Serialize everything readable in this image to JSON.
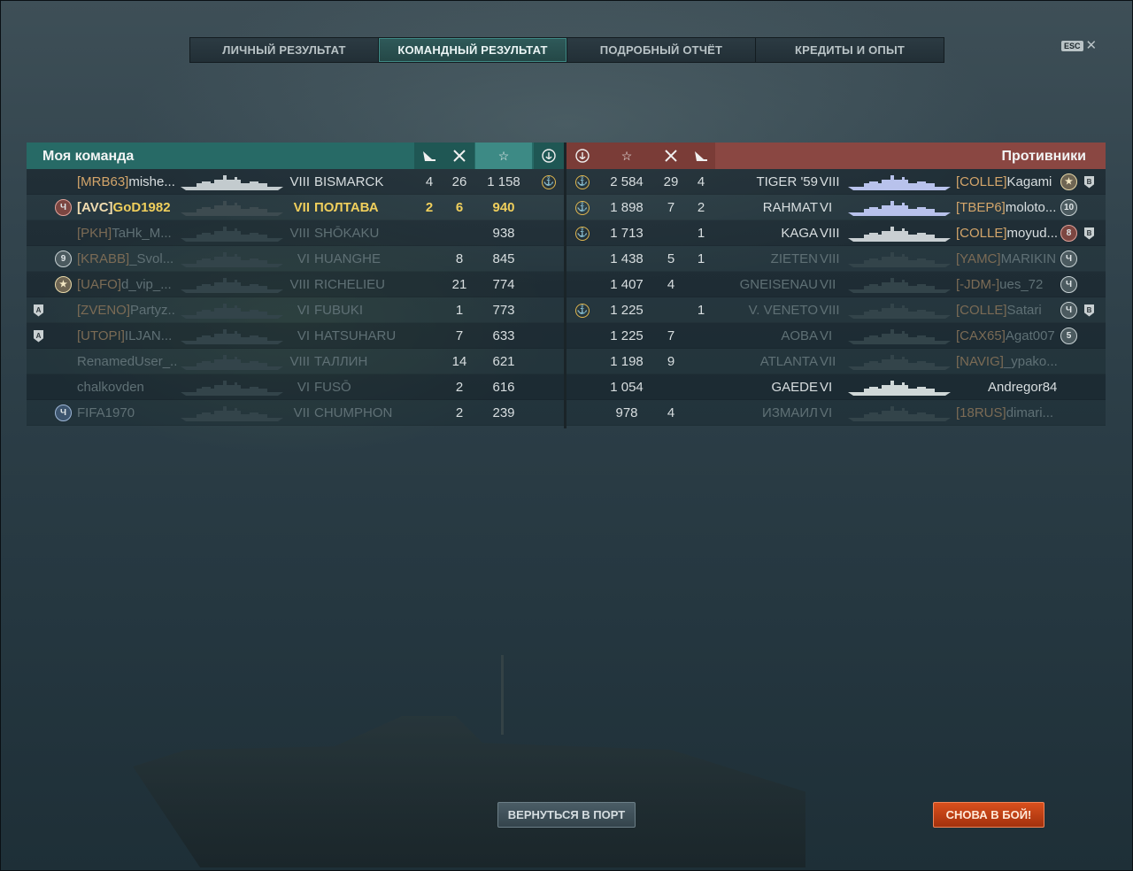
{
  "tabs": [
    {
      "label": "ЛИЧНЫЙ РЕЗУЛЬТАТ",
      "active": false
    },
    {
      "label": "КОМАНДНЫЙ РЕЗУЛЬТАТ",
      "active": true
    },
    {
      "label": "ПОДРОБНЫЙ ОТЧЁТ",
      "active": false
    },
    {
      "label": "КРЕДИТЫ И ОПЫТ",
      "active": false
    }
  ],
  "esc_key": "ESC",
  "close_glyph": "✕",
  "ally": {
    "title": "Моя команда",
    "header_icons": [
      "torpedo-icon",
      "frags-icon",
      "star-icon",
      "anchor-icon"
    ],
    "rows": [
      {
        "badge": "",
        "clan": "[MRB63]",
        "name": "mishe...",
        "tier": "VIII",
        "ship": "BISMARCK",
        "torpedo": "4",
        "frags": "26",
        "xp": "1 158",
        "anchor": true,
        "state": "alive"
      },
      {
        "badge": "Ч",
        "badge_style": "red",
        "clan": "[AVC]",
        "name": "GoD1982",
        "tier": "VII",
        "ship": "ПОЛТАВА",
        "torpedo": "2",
        "frags": "6",
        "xp": "940",
        "anchor": false,
        "state": "me"
      },
      {
        "badge": "",
        "clan": "[PKH]",
        "name": "TaHk_M...",
        "tier": "VIII",
        "ship": "SHŌKAKU",
        "torpedo": "",
        "frags": "",
        "xp": "938",
        "anchor": false,
        "state": "dead"
      },
      {
        "badge": "9",
        "clan": "[KRABB]",
        "name": "_Svol...",
        "tier": "VI",
        "ship": "HUANGHE",
        "torpedo": "",
        "frags": "8",
        "xp": "845",
        "anchor": false,
        "state": "dead"
      },
      {
        "badge": "★",
        "badge_style": "star",
        "clan": "[UAFO]",
        "name": "d_vip_...",
        "tier": "VIII",
        "ship": "RICHELIEU",
        "torpedo": "",
        "frags": "21",
        "xp": "774",
        "anchor": false,
        "state": "dead"
      },
      {
        "badge": "",
        "shield": "A",
        "clan": "[ZVENO]",
        "name": "Partyz...",
        "tier": "VI",
        "ship": "FUBUKI",
        "torpedo": "",
        "frags": "1",
        "xp": "773",
        "anchor": false,
        "state": "dead"
      },
      {
        "badge": "",
        "shield": "A",
        "clan": "[UTOPI]",
        "name": "ILJAN...",
        "tier": "VI",
        "ship": "HATSUHARU",
        "torpedo": "",
        "frags": "7",
        "xp": "633",
        "anchor": false,
        "state": "dead"
      },
      {
        "badge": "",
        "clan": "",
        "name": "RenamedUser_...",
        "tier": "VIII",
        "ship": "ТАЛЛИН",
        "torpedo": "",
        "frags": "14",
        "xp": "621",
        "anchor": false,
        "state": "dead"
      },
      {
        "badge": "",
        "clan": "",
        "name": "chalkovden",
        "tier": "VI",
        "ship": "FUSŌ",
        "torpedo": "",
        "frags": "2",
        "xp": "616",
        "anchor": false,
        "state": "dead"
      },
      {
        "badge": "Ч",
        "badge_style": "blue",
        "clan": "",
        "name": "FIFA1970",
        "tier": "VII",
        "ship": "CHUMPHON",
        "torpedo": "",
        "frags": "2",
        "xp": "239",
        "anchor": false,
        "state": "dead"
      }
    ]
  },
  "enemy": {
    "title": "Противники",
    "header_icons": [
      "anchor-icon",
      "star-icon",
      "frags-icon",
      "torpedo-icon"
    ],
    "rows": [
      {
        "anchor": true,
        "xp": "2 584",
        "frags": "29",
        "torpedo": "4",
        "ship": "TIGER '59",
        "tier": "VIII",
        "clan": "[COLLE]",
        "name": "Kagami",
        "badge": "★",
        "badge_style": "star",
        "shield": "B",
        "state": "alive"
      },
      {
        "anchor": true,
        "xp": "1 898",
        "frags": "7",
        "torpedo": "2",
        "ship": "RAHMAT",
        "tier": "VI",
        "clan": "[TBEP6]",
        "name": "moloto...",
        "badge": "10",
        "shield": "",
        "state": "alive"
      },
      {
        "anchor": true,
        "xp": "1 713",
        "frags": "",
        "torpedo": "1",
        "ship": "KAGA",
        "tier": "VIII",
        "clan": "[COLLE]",
        "name": "moyud...",
        "badge": "8",
        "badge_style": "red",
        "shield": "B",
        "state": "alive"
      },
      {
        "anchor": false,
        "xp": "1 438",
        "frags": "5",
        "torpedo": "1",
        "ship": "ZIETEN",
        "tier": "VIII",
        "clan": "[YAMC]",
        "name": "MARIKIN",
        "badge": "Ч",
        "shield": "",
        "state": "dead"
      },
      {
        "anchor": false,
        "xp": "1 407",
        "frags": "4",
        "torpedo": "",
        "ship": "GNEISENAU",
        "tier": "VII",
        "clan": "[-JDM-]",
        "name": "ues_72",
        "badge": "Ч",
        "shield": "",
        "state": "dead"
      },
      {
        "anchor": true,
        "xp": "1 225",
        "frags": "",
        "torpedo": "1",
        "ship": "V. VENETO",
        "tier": "VIII",
        "clan": "[COLLE]",
        "name": "Satari",
        "badge": "Ч",
        "shield": "B",
        "state": "dead"
      },
      {
        "anchor": false,
        "xp": "1 225",
        "frags": "7",
        "torpedo": "",
        "ship": "AOBA",
        "tier": "VI",
        "clan": "[CAX65]",
        "name": "Agat007",
        "badge": "5",
        "shield": "",
        "state": "dead"
      },
      {
        "anchor": false,
        "xp": "1 198",
        "frags": "9",
        "torpedo": "",
        "ship": "ATLANTA",
        "tier": "VII",
        "clan": "[NAVIG]",
        "name": "_ypako...",
        "badge": "",
        "shield": "",
        "state": "dead"
      },
      {
        "anchor": false,
        "xp": "1 054",
        "frags": "",
        "torpedo": "",
        "ship": "GAEDE",
        "tier": "VI",
        "clan": "",
        "name": "Andregor84",
        "badge": "",
        "shield": "",
        "state": "alive"
      },
      {
        "anchor": false,
        "xp": "978",
        "frags": "4",
        "torpedo": "",
        "ship": "ИЗМАИЛ",
        "tier": "VI",
        "clan": "[18RUS]",
        "name": "dimari...",
        "badge": "",
        "shield": "",
        "state": "dead"
      }
    ]
  },
  "buttons": {
    "to_port": "ВЕРНУТЬСЯ В ПОРТ",
    "battle_again": "СНОВА В БОЙ!"
  },
  "colors": {
    "ally_header": "#276a66",
    "enemy_header": "#8a4742",
    "clan_tag": "#d3a56a",
    "me_highlight": "#f0cf5c",
    "battle_button": "#d9501d"
  }
}
